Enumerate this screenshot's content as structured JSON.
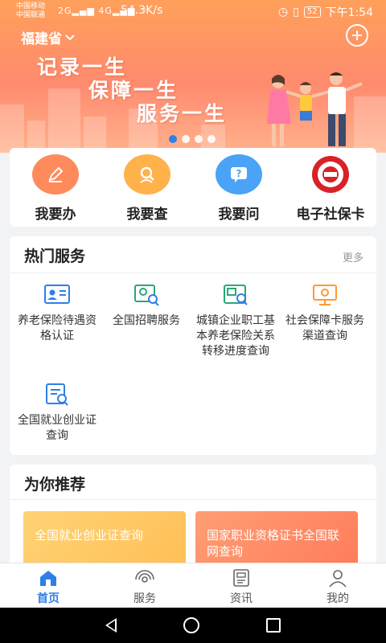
{
  "status_bar": {
    "carrier1": "中国移动",
    "carrier2": "中国联通",
    "net1": "2G",
    "net2": "4G",
    "speed": "54.3K/s",
    "battery": "52",
    "time": "下午1:54"
  },
  "header": {
    "province": "福建省",
    "slogan": [
      "记录一生",
      "保障一生",
      "服务一生"
    ],
    "carousel_count": 4,
    "carousel_active": 0
  },
  "quick_actions": [
    {
      "label": "我要办",
      "icon": "pencil-icon",
      "color": "#ff8a5c"
    },
    {
      "label": "我要查",
      "icon": "search-person-icon",
      "color": "#ffb14a"
    },
    {
      "label": "我要问",
      "icon": "question-chat-icon",
      "color": "#4aa3f7"
    },
    {
      "label": "电子社保卡",
      "icon": "social-security-card-icon",
      "color": "#d92128"
    }
  ],
  "hot_services": {
    "title": "热门服务",
    "more": "更多",
    "items": [
      {
        "label": "养老保险待遇资格认证",
        "icon": "id-card-icon"
      },
      {
        "label": "全国招聘服务",
        "icon": "recruit-search-icon"
      },
      {
        "label": "城镇企业职工基本养老保险关系转移进度查询",
        "icon": "transfer-query-icon"
      },
      {
        "label": "社会保障卡服务渠道查询",
        "icon": "monitor-icon"
      },
      {
        "label": "全国就业创业证查询",
        "icon": "document-search-icon"
      }
    ]
  },
  "recommend": {
    "title": "为你推荐",
    "cards": [
      {
        "label": "全国就业创业证查询"
      },
      {
        "label": "国家职业资格证书全国联网查询"
      }
    ]
  },
  "tabbar": [
    {
      "label": "首页",
      "icon": "home-icon",
      "active": true
    },
    {
      "label": "服务",
      "icon": "signal-icon",
      "active": false
    },
    {
      "label": "资讯",
      "icon": "news-icon",
      "active": false
    },
    {
      "label": "我的",
      "icon": "user-icon",
      "active": false
    }
  ],
  "colors": {
    "accent": "#2f7fe6",
    "banner_top": "#ffa05a",
    "banner_bottom": "#ff8a6e"
  }
}
